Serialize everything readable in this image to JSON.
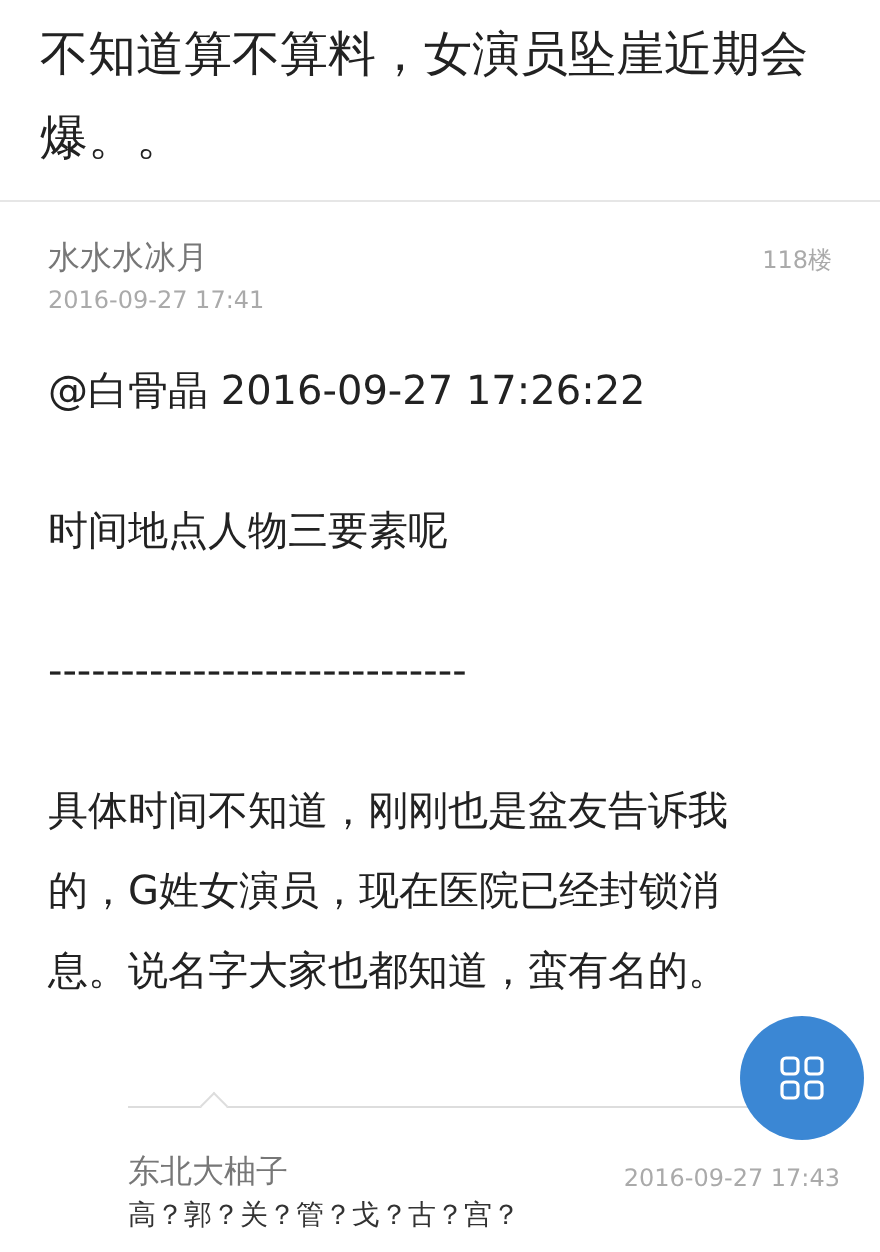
{
  "post_title": "不知道算不算料，女演员坠崖近期会爆。。",
  "reply": {
    "author": "水水水冰月",
    "time": "2016-09-27 17:41",
    "floor": "118楼",
    "paragraphs": [
      "@白骨晶 2016-09-27 17:26:22",
      "时间地点人物三要素呢",
      "-----------------------------",
      "具体时间不知道，刚刚也是盆友告诉我的，G姓女演员，现在医院已经封锁消息。说名字大家也都知道，蛮有名的。"
    ]
  },
  "sub_reply": {
    "author": "东北大柚子",
    "time": "2016-09-27 17:43",
    "text": "高？郭？关？管？戈？古？宫？"
  }
}
